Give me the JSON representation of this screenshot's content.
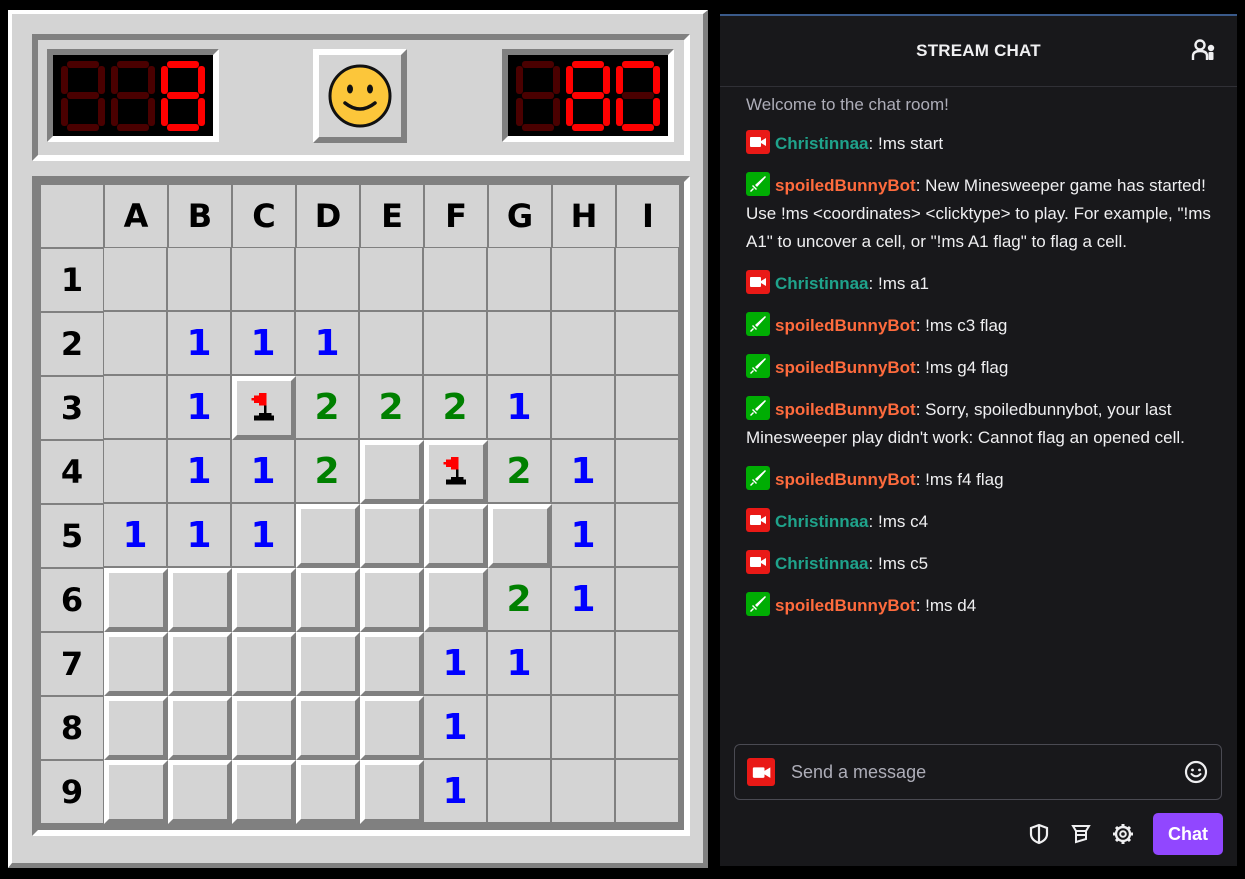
{
  "game": {
    "mine_counter": "008",
    "timer": "080",
    "face": "smiley-face",
    "columns": [
      "A",
      "B",
      "C",
      "D",
      "E",
      "F",
      "G",
      "H",
      "I"
    ],
    "rows": [
      "1",
      "2",
      "3",
      "4",
      "5",
      "6",
      "7",
      "8",
      "9"
    ],
    "board": [
      [
        "",
        "",
        "",
        "",
        "",
        "",
        "",
        "",
        ""
      ],
      [
        "",
        "1",
        "1",
        "1",
        "",
        "",
        "",
        "",
        ""
      ],
      [
        "",
        "1",
        "F",
        "2",
        "2",
        "2",
        "1",
        "",
        ""
      ],
      [
        "",
        "1",
        "1",
        "2",
        "H",
        "F",
        "2",
        "1",
        ""
      ],
      [
        "1",
        "1",
        "1",
        "H",
        "H",
        "H",
        "H",
        "1",
        ""
      ],
      [
        "H",
        "H",
        "H",
        "H",
        "H",
        "H",
        "2",
        "1",
        ""
      ],
      [
        "H",
        "H",
        "H",
        "H",
        "H",
        "1",
        "1",
        "",
        ""
      ],
      [
        "H",
        "H",
        "H",
        "H",
        "H",
        "1",
        "",
        "",
        ""
      ],
      [
        "H",
        "H",
        "H",
        "H",
        "H",
        "1",
        "",
        "",
        ""
      ]
    ],
    "board_legend": {
      "H": "unrevealed",
      "F": "flagged",
      "": "revealed-empty"
    },
    "number_colors": {
      "1": "#0000ff",
      "2": "#008000"
    }
  },
  "chat": {
    "title": "STREAM CHAT",
    "welcome": "Welcome to the chat room!",
    "messages": [
      {
        "badge": "broadcaster",
        "user": "Christinnaa",
        "text": "!ms start"
      },
      {
        "badge": "moderator",
        "user": "spoiledBunnyBot",
        "text": "New Minesweeper game has started! Use !ms <coordinates> <clicktype> to play. For example, \"!ms A1\" to uncover a cell, or \"!ms A1 flag\" to flag a cell."
      },
      {
        "badge": "broadcaster",
        "user": "Christinnaa",
        "text": "!ms a1"
      },
      {
        "badge": "moderator",
        "user": "spoiledBunnyBot",
        "text": "!ms c3 flag"
      },
      {
        "badge": "moderator",
        "user": "spoiledBunnyBot",
        "text": "!ms g4 flag"
      },
      {
        "badge": "moderator",
        "user": "spoiledBunnyBot",
        "text": "Sorry, spoiledbunnybot, your last Minesweeper play didn't work: Cannot flag an opened cell."
      },
      {
        "badge": "moderator",
        "user": "spoiledBunnyBot",
        "text": "!ms f4 flag"
      },
      {
        "badge": "broadcaster",
        "user": "Christinnaa",
        "text": "!ms c4"
      },
      {
        "badge": "broadcaster",
        "user": "Christinnaa",
        "text": "!ms c5"
      },
      {
        "badge": "moderator",
        "user": "spoiledBunnyBot",
        "text": "!ms d4"
      }
    ],
    "user_colors": {
      "Christinnaa": "#1fa38b",
      "spoiledBunnyBot": "#ff6b3d"
    },
    "input_placeholder": "Send a message",
    "send_label": "Chat",
    "accent": "#9147ff"
  }
}
